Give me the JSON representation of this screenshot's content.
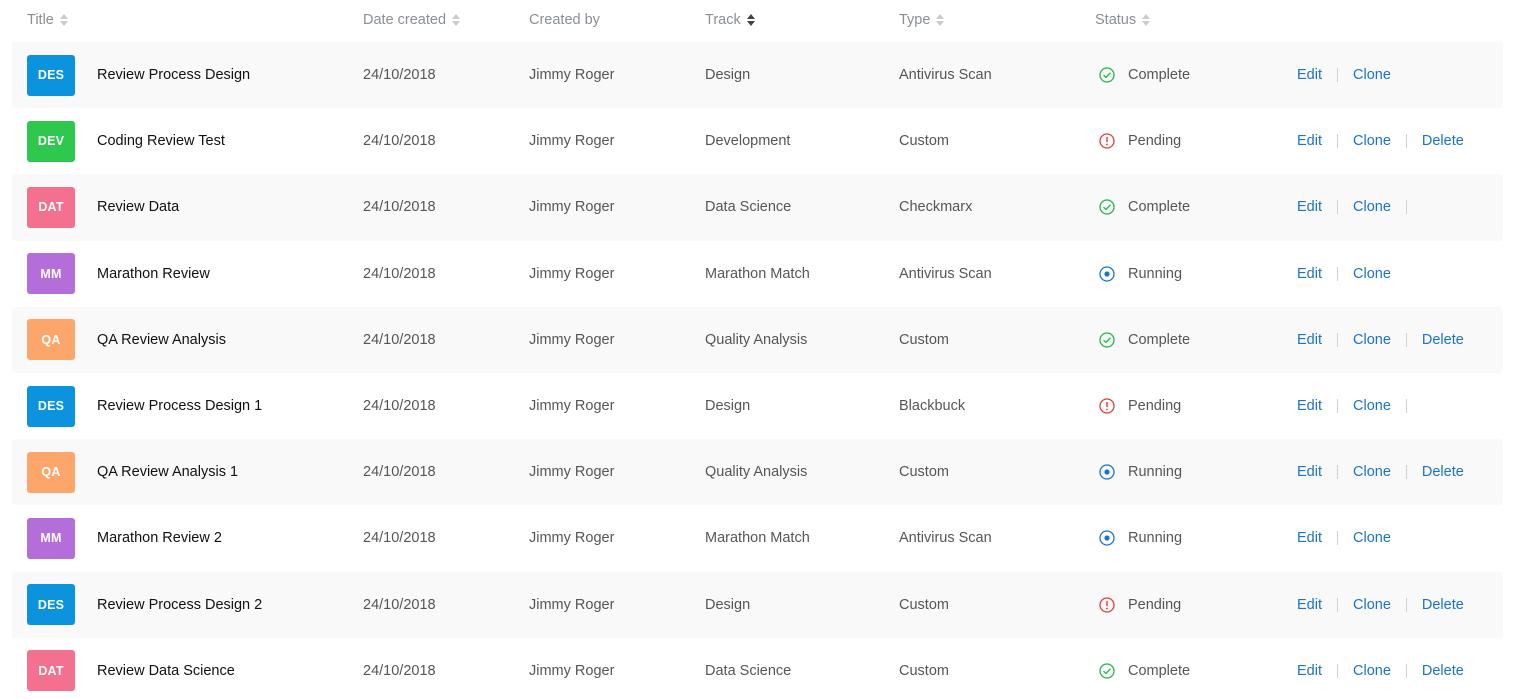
{
  "columns": {
    "title": "Title",
    "date_created": "Date created",
    "created_by": "Created by",
    "track": "Track",
    "type": "Type",
    "status": "Status"
  },
  "colors": {
    "DES": "#0b93dd",
    "DEV": "#2fc84f",
    "DAT": "#f4708f",
    "MM": "#b36ed9",
    "QA": "#fca66b",
    "complete": "#27b24a",
    "pending": "#e03c3c",
    "running": "#1a73c8"
  },
  "actions": {
    "edit": "Edit",
    "clone": "Clone",
    "delete": "Delete"
  },
  "rows": [
    {
      "badge": "DES",
      "title": "Review Process Design",
      "date": "24/10/2018",
      "created_by": "Jimmy Roger",
      "track": "Design",
      "type": "Antivirus Scan",
      "status": "Complete",
      "status_key": "complete",
      "delete": false,
      "trailing_sep": false
    },
    {
      "badge": "DEV",
      "title": "Coding Review Test",
      "date": "24/10/2018",
      "created_by": "Jimmy Roger",
      "track": "Development",
      "type": "Custom",
      "status": "Pending",
      "status_key": "pending",
      "delete": true,
      "trailing_sep": false
    },
    {
      "badge": "DAT",
      "title": "Review Data",
      "date": "24/10/2018",
      "created_by": "Jimmy Roger",
      "track": "Data Science",
      "type": "Checkmarx",
      "status": "Complete",
      "status_key": "complete",
      "delete": false,
      "trailing_sep": true
    },
    {
      "badge": "MM",
      "title": "Marathon Review",
      "date": "24/10/2018",
      "created_by": "Jimmy Roger",
      "track": "Marathon Match",
      "type": "Antivirus Scan",
      "status": "Running",
      "status_key": "running",
      "delete": false,
      "trailing_sep": false
    },
    {
      "badge": "QA",
      "title": "QA Review Analysis",
      "date": "24/10/2018",
      "created_by": "Jimmy Roger",
      "track": "Quality Analysis",
      "type": "Custom",
      "status": "Complete",
      "status_key": "complete",
      "delete": true,
      "trailing_sep": false
    },
    {
      "badge": "DES",
      "title": "Review Process Design 1",
      "date": "24/10/2018",
      "created_by": "Jimmy Roger",
      "track": "Design",
      "type": "Blackbuck",
      "status": "Pending",
      "status_key": "pending",
      "delete": false,
      "trailing_sep": true
    },
    {
      "badge": "QA",
      "title": "QA Review Analysis 1",
      "date": "24/10/2018",
      "created_by": "Jimmy Roger",
      "track": "Quality Analysis",
      "type": "Custom",
      "status": "Running",
      "status_key": "running",
      "delete": true,
      "trailing_sep": false
    },
    {
      "badge": "MM",
      "title": "Marathon Review 2",
      "date": "24/10/2018",
      "created_by": "Jimmy Roger",
      "track": "Marathon Match",
      "type": "Antivirus Scan",
      "status": "Running",
      "status_key": "running",
      "delete": false,
      "trailing_sep": false
    },
    {
      "badge": "DES",
      "title": "Review Process Design 2",
      "date": "24/10/2018",
      "created_by": "Jimmy Roger",
      "track": "Design",
      "type": "Custom",
      "status": "Pending",
      "status_key": "pending",
      "delete": true,
      "trailing_sep": false
    },
    {
      "badge": "DAT",
      "title": "Review Data Science",
      "date": "24/10/2018",
      "created_by": "Jimmy Roger",
      "track": "Data Science",
      "type": "Custom",
      "status": "Complete",
      "status_key": "complete",
      "delete": true,
      "trailing_sep": false
    }
  ]
}
